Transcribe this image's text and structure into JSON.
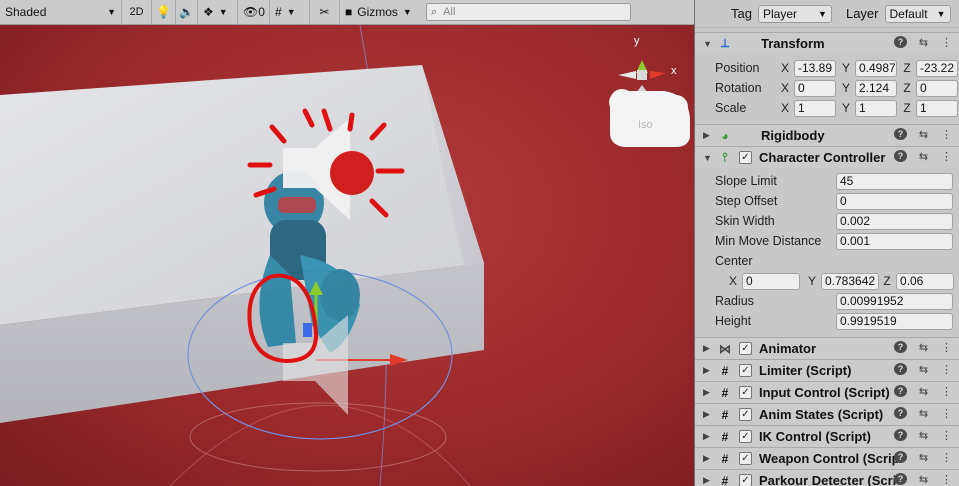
{
  "toolbar": {
    "shading_mode": "Shaded",
    "mode_2d": "2D",
    "hidden_count": "0",
    "gizmos_label": "Gizmos",
    "search_placeholder": "All"
  },
  "scene": {
    "projection_label": "Iso",
    "axis_y": "y",
    "axis_x": "x"
  },
  "inspector": {
    "tag_label": "Tag",
    "tag_value": "Player",
    "layer_label": "Layer",
    "layer_value": "Default",
    "transform": {
      "title": "Transform",
      "position_label": "Position",
      "rotation_label": "Rotation",
      "scale_label": "Scale",
      "position": {
        "x": "-13.89",
        "y": "0.4987",
        "z": "-23.22"
      },
      "rotation": {
        "x": "0",
        "y": "2.124",
        "z": "0"
      },
      "scale": {
        "x": "1",
        "y": "1",
        "z": "1"
      }
    },
    "rigidbody": {
      "title": "Rigidbody"
    },
    "character_controller": {
      "title": "Character Controller",
      "slope_limit_label": "Slope Limit",
      "slope_limit": "45",
      "step_offset_label": "Step Offset",
      "step_offset": "0",
      "skin_width_label": "Skin Width",
      "skin_width": "0.002",
      "min_move_label": "Min Move Distance",
      "min_move": "0.001",
      "center_label": "Center",
      "center": {
        "x": "0",
        "y": "0.783642",
        "z": "0.06"
      },
      "radius_label": "Radius",
      "radius": "0.00991952",
      "height_label": "Height",
      "height": "0.9919519"
    },
    "components": [
      {
        "title": "Animator",
        "icon": "animator-icon"
      },
      {
        "title": "Limiter (Script)",
        "icon": "script-icon"
      },
      {
        "title": "Input Control (Script)",
        "icon": "script-icon"
      },
      {
        "title": "Anim States (Script)",
        "icon": "script-icon"
      },
      {
        "title": "IK Control (Script)",
        "icon": "script-icon"
      },
      {
        "title": "Weapon Control (Script",
        "icon": "script-icon"
      },
      {
        "title": "Parkour Detecter (Scri",
        "icon": "script-icon"
      }
    ],
    "axis_labels": {
      "x": "X",
      "y": "Y",
      "z": "Z"
    }
  },
  "colors": {
    "scene_bg": "#a83133",
    "annotation_red": "#e01010",
    "gizmo_green": "#8ccc2a",
    "gizmo_red": "#e23a2a",
    "gizmo_blue": "#3c6ce6",
    "collider_blue": "#6f8fd8",
    "character_blue": "#2f8fb0"
  }
}
